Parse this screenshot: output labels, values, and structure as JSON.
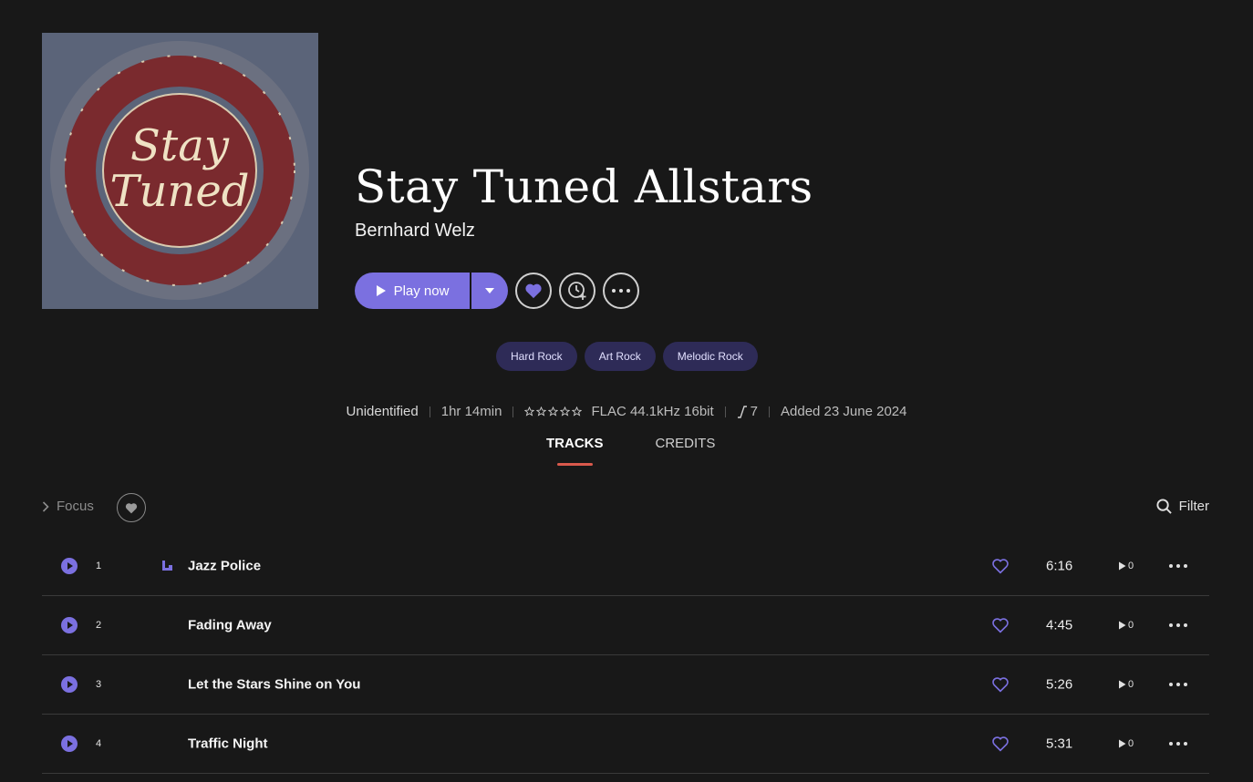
{
  "album": {
    "title": "Stay Tuned Allstars",
    "artist": "Bernhard Welz",
    "cover_text": "Stay Tuned"
  },
  "actions": {
    "play_label": "Play now",
    "accent": "#7b70e0"
  },
  "tags": [
    "Hard Rock",
    "Art Rock",
    "Melodic Rock"
  ],
  "meta": {
    "status": "Unidentified",
    "duration": "1hr 14min",
    "rating": 0,
    "format": "FLAC 44.1kHz 16bit",
    "dynamic_range": "7",
    "added": "Added 23 June 2024"
  },
  "tabs": [
    {
      "label": "TRACKS",
      "active": true
    },
    {
      "label": "CREDITS",
      "active": false
    }
  ],
  "toolbar": {
    "focus_label": "Focus",
    "filter_label": "Filter"
  },
  "tracks": [
    {
      "number": "1",
      "title": "Jazz Police",
      "duration": "6:16",
      "plays": "0",
      "playing": true
    },
    {
      "number": "2",
      "title": "Fading Away",
      "duration": "4:45",
      "plays": "0",
      "playing": false
    },
    {
      "number": "3",
      "title": "Let the Stars Shine on You",
      "duration": "5:26",
      "plays": "0",
      "playing": false
    },
    {
      "number": "4",
      "title": "Traffic Night",
      "duration": "5:31",
      "plays": "0",
      "playing": false
    }
  ]
}
